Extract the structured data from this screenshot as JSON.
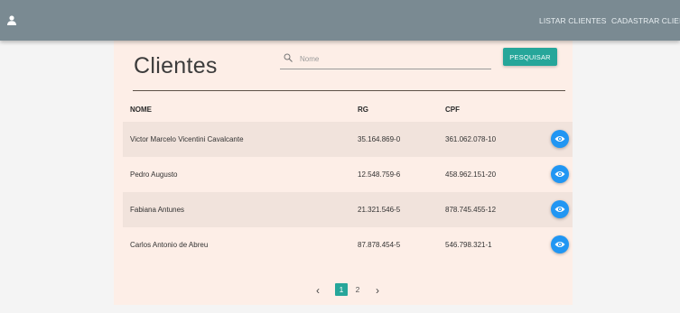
{
  "navbar": {
    "user_icon": "person-icon",
    "links": [
      {
        "label": "LISTAR CLIENTES"
      },
      {
        "label": "CADASTRAR CLIENT"
      }
    ],
    "color": "#7a8a92"
  },
  "page": {
    "title": "Clientes"
  },
  "search": {
    "placeholder": "Nome",
    "value": "",
    "button_label": "PESQUISAR",
    "icon": "search-icon"
  },
  "table": {
    "headers": [
      "NOME",
      "RG",
      "CPF"
    ],
    "rows": [
      {
        "nome": "Victor Marcelo Vicentini Cavalcante",
        "rg": "35.164.869-0",
        "cpf": "361.062.078-10"
      },
      {
        "nome": "Pedro Augusto",
        "rg": "12.548.759-6",
        "cpf": "458.962.151-20"
      },
      {
        "nome": "Fabiana Antunes",
        "rg": "21.321.546-5",
        "cpf": "878.745.455-12"
      },
      {
        "nome": "Carlos Antonio de Abreu",
        "rg": "87.878.454-5",
        "cpf": "546.798.321-1"
      }
    ],
    "row_action_icon": "eye-icon"
  },
  "pagination": {
    "pages": [
      "1",
      "2"
    ],
    "current": "1"
  },
  "colors": {
    "accent": "#26a69a",
    "action": "#2196f3",
    "card_bg": "#fdeee7"
  }
}
